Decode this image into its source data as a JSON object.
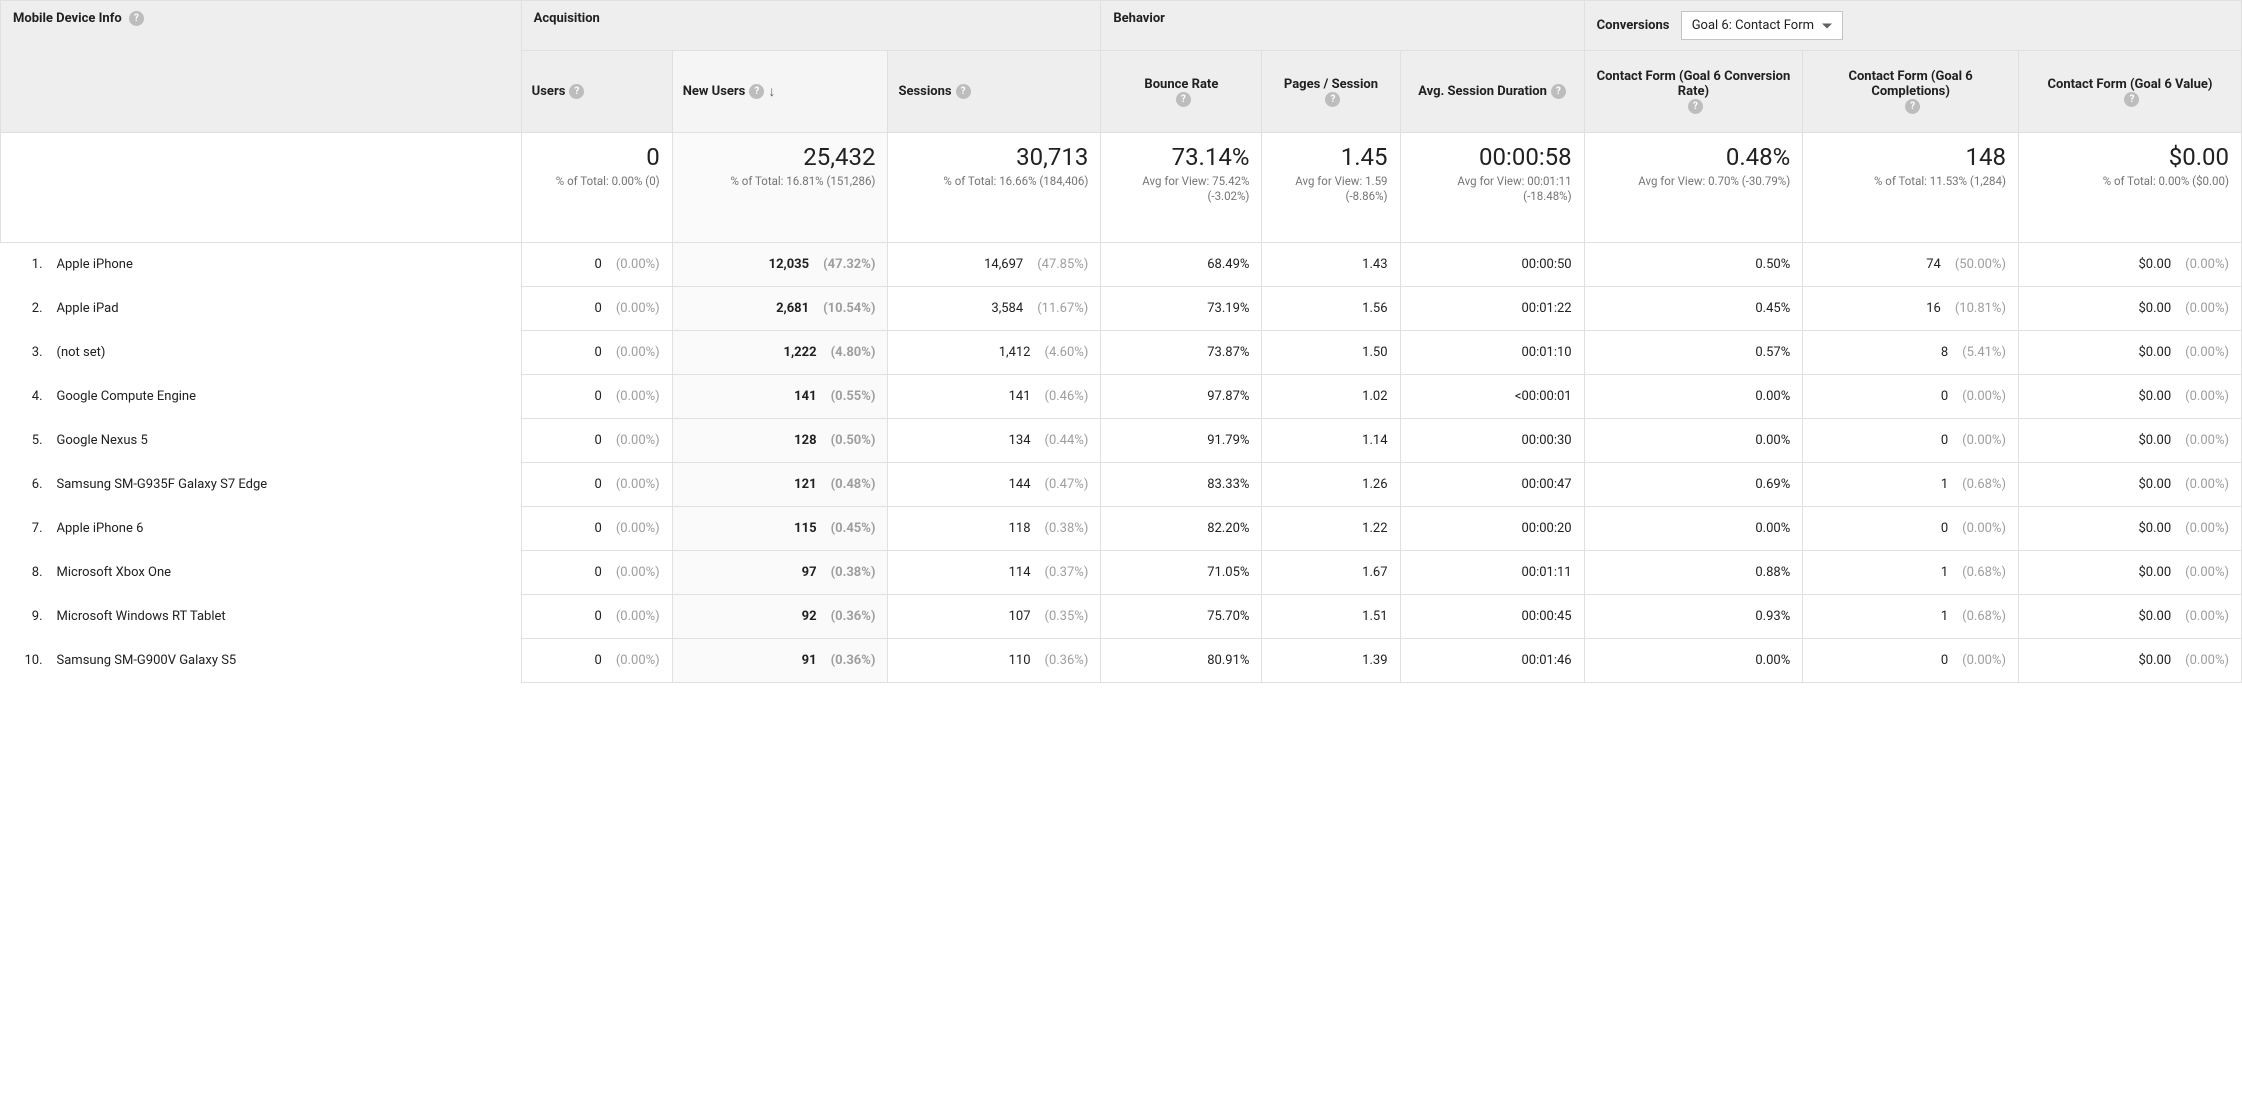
{
  "dimension_label": "Mobile Device Info",
  "groups": {
    "acquisition": "Acquisition",
    "behavior": "Behavior",
    "conversions": "Conversions"
  },
  "goal_selector": "Goal 6: Contact Form",
  "columns": {
    "users": "Users",
    "new_users": "New Users",
    "sessions": "Sessions",
    "bounce_rate": "Bounce Rate",
    "pages_session": "Pages / Session",
    "avg_duration": "Avg. Session Duration",
    "conv_rate": "Contact Form (Goal 6 Conversion Rate)",
    "completions": "Contact Form (Goal 6 Completions)",
    "value": "Contact Form (Goal 6 Value)"
  },
  "summary": {
    "users": {
      "big": "0",
      "sub": "% of Total: 0.00% (0)"
    },
    "new_users": {
      "big": "25,432",
      "sub": "% of Total: 16.81% (151,286)"
    },
    "sessions": {
      "big": "30,713",
      "sub": "% of Total: 16.66% (184,406)"
    },
    "bounce_rate": {
      "big": "73.14%",
      "sub": "Avg for View: 75.42% (-3.02%)"
    },
    "pages_session": {
      "big": "1.45",
      "sub": "Avg for View: 1.59 (-8.86%)"
    },
    "avg_duration": {
      "big": "00:00:58",
      "sub": "Avg for View: 00:01:11 (-18.48%)"
    },
    "conv_rate": {
      "big": "0.48%",
      "sub": "Avg for View: 0.70% (-30.79%)"
    },
    "completions": {
      "big": "148",
      "sub": "% of Total: 11.53% (1,284)"
    },
    "value": {
      "big": "$0.00",
      "sub": "% of Total: 0.00% ($0.00)"
    }
  },
  "rows": [
    {
      "idx": "1.",
      "device": "Apple iPhone",
      "users": "0",
      "users_pct": "(0.00%)",
      "new_users": "12,035",
      "new_users_pct": "(47.32%)",
      "sessions": "14,697",
      "sessions_pct": "(47.85%)",
      "bounce": "68.49%",
      "pps": "1.43",
      "dur": "00:00:50",
      "conv": "0.50%",
      "comp": "74",
      "comp_pct": "(50.00%)",
      "val": "$0.00",
      "val_pct": "(0.00%)"
    },
    {
      "idx": "2.",
      "device": "Apple iPad",
      "users": "0",
      "users_pct": "(0.00%)",
      "new_users": "2,681",
      "new_users_pct": "(10.54%)",
      "sessions": "3,584",
      "sessions_pct": "(11.67%)",
      "bounce": "73.19%",
      "pps": "1.56",
      "dur": "00:01:22",
      "conv": "0.45%",
      "comp": "16",
      "comp_pct": "(10.81%)",
      "val": "$0.00",
      "val_pct": "(0.00%)"
    },
    {
      "idx": "3.",
      "device": "(not set)",
      "users": "0",
      "users_pct": "(0.00%)",
      "new_users": "1,222",
      "new_users_pct": "(4.80%)",
      "sessions": "1,412",
      "sessions_pct": "(4.60%)",
      "bounce": "73.87%",
      "pps": "1.50",
      "dur": "00:01:10",
      "conv": "0.57%",
      "comp": "8",
      "comp_pct": "(5.41%)",
      "val": "$0.00",
      "val_pct": "(0.00%)"
    },
    {
      "idx": "4.",
      "device": "Google Compute Engine",
      "users": "0",
      "users_pct": "(0.00%)",
      "new_users": "141",
      "new_users_pct": "(0.55%)",
      "sessions": "141",
      "sessions_pct": "(0.46%)",
      "bounce": "97.87%",
      "pps": "1.02",
      "dur": "<00:00:01",
      "conv": "0.00%",
      "comp": "0",
      "comp_pct": "(0.00%)",
      "val": "$0.00",
      "val_pct": "(0.00%)"
    },
    {
      "idx": "5.",
      "device": "Google Nexus 5",
      "users": "0",
      "users_pct": "(0.00%)",
      "new_users": "128",
      "new_users_pct": "(0.50%)",
      "sessions": "134",
      "sessions_pct": "(0.44%)",
      "bounce": "91.79%",
      "pps": "1.14",
      "dur": "00:00:30",
      "conv": "0.00%",
      "comp": "0",
      "comp_pct": "(0.00%)",
      "val": "$0.00",
      "val_pct": "(0.00%)"
    },
    {
      "idx": "6.",
      "device": "Samsung SM-G935F Galaxy S7 Edge",
      "users": "0",
      "users_pct": "(0.00%)",
      "new_users": "121",
      "new_users_pct": "(0.48%)",
      "sessions": "144",
      "sessions_pct": "(0.47%)",
      "bounce": "83.33%",
      "pps": "1.26",
      "dur": "00:00:47",
      "conv": "0.69%",
      "comp": "1",
      "comp_pct": "(0.68%)",
      "val": "$0.00",
      "val_pct": "(0.00%)"
    },
    {
      "idx": "7.",
      "device": "Apple iPhone 6",
      "users": "0",
      "users_pct": "(0.00%)",
      "new_users": "115",
      "new_users_pct": "(0.45%)",
      "sessions": "118",
      "sessions_pct": "(0.38%)",
      "bounce": "82.20%",
      "pps": "1.22",
      "dur": "00:00:20",
      "conv": "0.00%",
      "comp": "0",
      "comp_pct": "(0.00%)",
      "val": "$0.00",
      "val_pct": "(0.00%)"
    },
    {
      "idx": "8.",
      "device": "Microsoft Xbox One",
      "users": "0",
      "users_pct": "(0.00%)",
      "new_users": "97",
      "new_users_pct": "(0.38%)",
      "sessions": "114",
      "sessions_pct": "(0.37%)",
      "bounce": "71.05%",
      "pps": "1.67",
      "dur": "00:01:11",
      "conv": "0.88%",
      "comp": "1",
      "comp_pct": "(0.68%)",
      "val": "$0.00",
      "val_pct": "(0.00%)"
    },
    {
      "idx": "9.",
      "device": "Microsoft Windows RT Tablet",
      "users": "0",
      "users_pct": "(0.00%)",
      "new_users": "92",
      "new_users_pct": "(0.36%)",
      "sessions": "107",
      "sessions_pct": "(0.35%)",
      "bounce": "75.70%",
      "pps": "1.51",
      "dur": "00:00:45",
      "conv": "0.93%",
      "comp": "1",
      "comp_pct": "(0.68%)",
      "val": "$0.00",
      "val_pct": "(0.00%)"
    },
    {
      "idx": "10.",
      "device": "Samsung SM-G900V Galaxy S5",
      "users": "0",
      "users_pct": "(0.00%)",
      "new_users": "91",
      "new_users_pct": "(0.36%)",
      "sessions": "110",
      "sessions_pct": "(0.36%)",
      "bounce": "80.91%",
      "pps": "1.39",
      "dur": "00:01:46",
      "conv": "0.00%",
      "comp": "0",
      "comp_pct": "(0.00%)",
      "val": "$0.00",
      "val_pct": "(0.00%)"
    }
  ]
}
